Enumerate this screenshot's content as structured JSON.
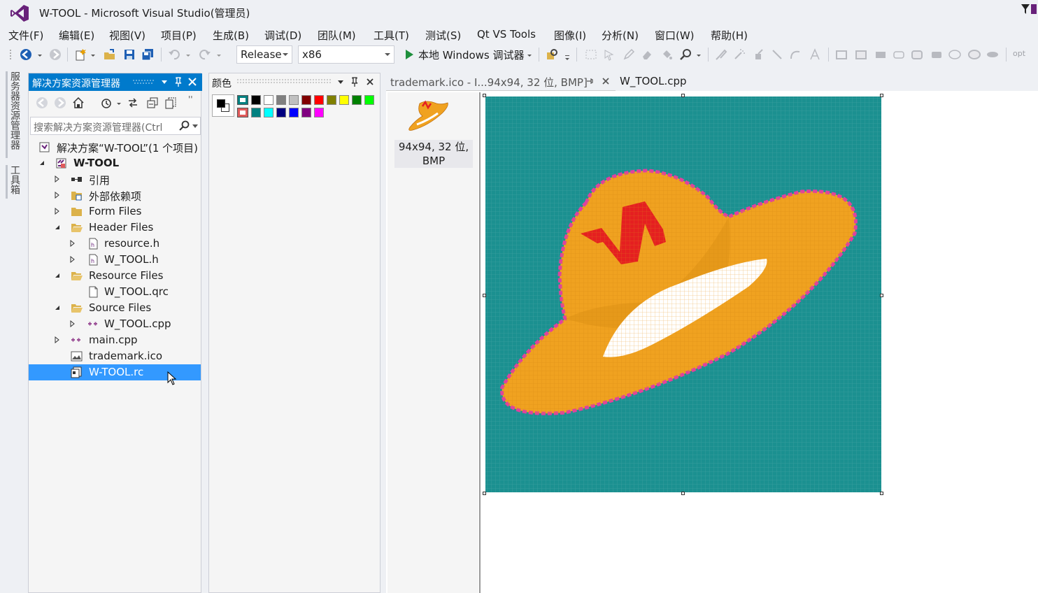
{
  "window": {
    "title": "W-TOOL - Microsoft Visual Studio(管理员)"
  },
  "menu": [
    "文件(F)",
    "编辑(E)",
    "视图(V)",
    "项目(P)",
    "生成(B)",
    "调试(D)",
    "团队(M)",
    "工具(T)",
    "测试(S)",
    "Qt VS Tools",
    "图像(I)",
    "分析(N)",
    "窗口(W)",
    "帮助(H)"
  ],
  "toolbar": {
    "config": "Release",
    "platform": "x86",
    "run_label": "本地 Windows 调试器",
    "opt_label": "opt"
  },
  "side_rail": {
    "tab1": "服务器资源管理器",
    "tab2": "工具箱"
  },
  "solution_explorer": {
    "title": "解决方案资源管理器",
    "search_placeholder": "搜索解决方案资源管理器(Ctrl",
    "tree": [
      "解决方案“W-TOOL”(1 个项目)",
      "W-TOOL",
      "引用",
      "外部依赖项",
      "Form Files",
      "Header Files",
      "resource.h",
      "W_TOOL.h",
      "Resource Files",
      "W_TOOL.qrc",
      "Source Files",
      "W_TOOL.cpp",
      "main.cpp",
      "trademark.ico",
      "W-TOOL.rc"
    ]
  },
  "color_panel": {
    "title": "颜色",
    "fg": "#000000",
    "bg": "#ffffff",
    "swatches_row1": [
      "#000000",
      "#ffffff",
      "#808080",
      "#c0c0c0",
      "#800000",
      "#ff0000",
      "#808000",
      "#ffff00",
      "#008000",
      "#00ff00"
    ],
    "swatches_row2": [
      "#008080",
      "#00ffff",
      "#000080",
      "#0000ff",
      "#800080",
      "#ff00ff"
    ]
  },
  "document": {
    "tabs": [
      "trademark.ico - I...94x94, 32 位, BMP]",
      "W_TOOL.cpp"
    ],
    "thumb_label": "94x94, 32 位, BMP"
  },
  "colors": {
    "accent": "#007acc",
    "selection": "#3399ff",
    "teal": "#1b9090",
    "hat": "#f0a220",
    "hat_dark": "#d58a10",
    "magenta": "#e040a0",
    "red": "#e52020"
  }
}
